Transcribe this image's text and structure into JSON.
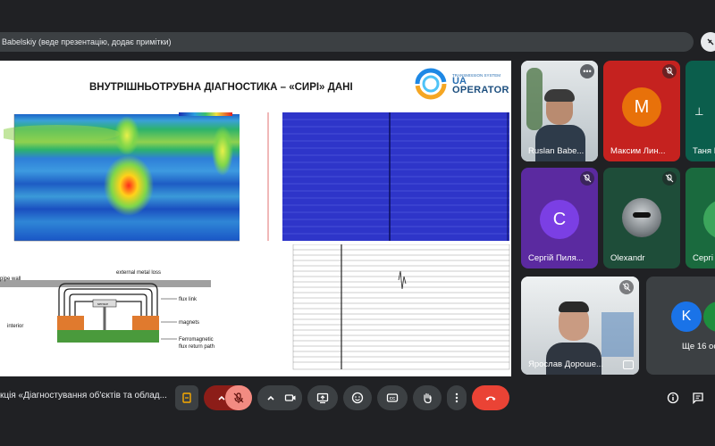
{
  "presenter": {
    "label": "Babelskiy (веде презентацію, додає примітки)"
  },
  "slide": {
    "title": "ВНУТРІШНЬОТРУБНА ДІАГНОСТИКА – «СИРІ» ДАНІ",
    "logo": {
      "small": "TRANSMISSION SYSTEM",
      "brand_top": "UA",
      "brand_bottom": "OPERATOR"
    },
    "diagram": {
      "pipe_wall": "pipe wall",
      "external_metal_loss": "external metal loss",
      "flux_link": "flux link",
      "sensor": "sensor",
      "magnets": "magnets",
      "interior": "interior",
      "ferromagnetic": "Ferromagnetic",
      "flux_return_path": "flux return path"
    }
  },
  "participants": [
    {
      "name": "Ruslan Babe...",
      "type": "video"
    },
    {
      "name": "Максим Лин...",
      "initial": "М",
      "color": "#e8710a",
      "bg": "#c5221f"
    },
    {
      "name": "Таня Б",
      "bg": "#0b5e4c"
    },
    {
      "name": "Сергій Пиля...",
      "initial": "С",
      "color": "#7b3fe4",
      "bg": "#5b2aa0"
    },
    {
      "name": "Olexandr",
      "type": "photo",
      "bg": "#1e4d39"
    },
    {
      "name": "Сергі",
      "bg": "#1a6a3e"
    },
    {
      "name": "Ярослав Дороше...",
      "type": "video"
    },
    {
      "name": "Ще 16 ос",
      "initial": "K",
      "bg": "#3c4043"
    }
  ],
  "meeting": {
    "title": "кція «Діагностування об'єктів та облад..."
  },
  "colors": {
    "background": "#202124",
    "end_call": "#ea4335",
    "mic_off": "#f28b82"
  }
}
